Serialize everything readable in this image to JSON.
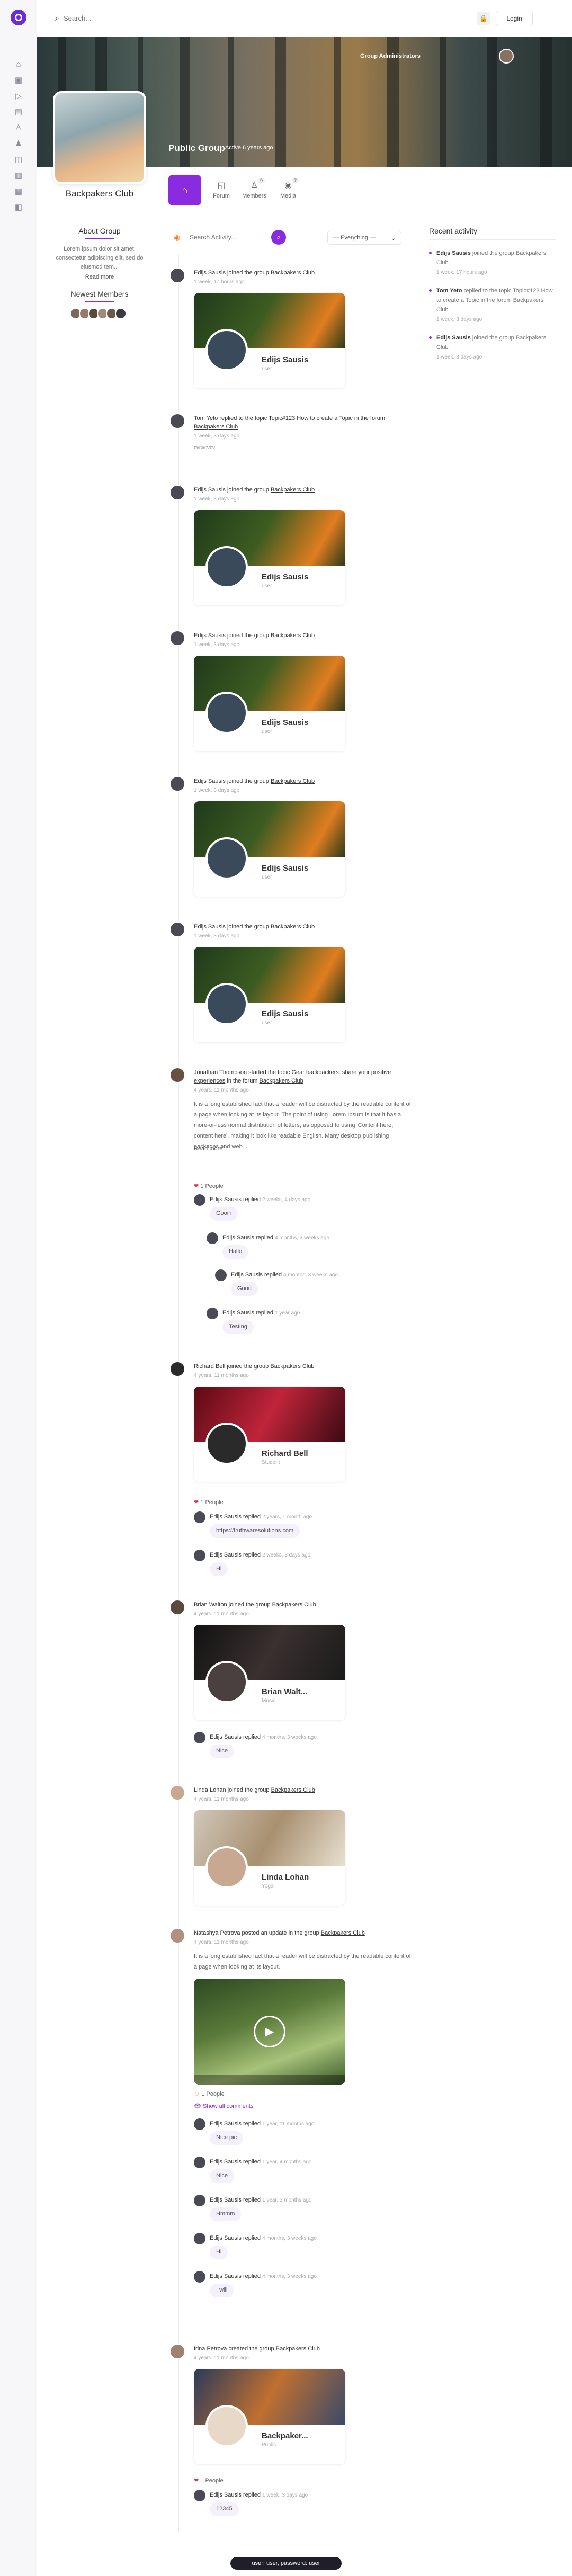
{
  "search": {
    "placeholder": "Search..."
  },
  "header": {
    "cart_icon": "cart-icon",
    "login_label": "Login"
  },
  "sidebar": {
    "icons": [
      "home-icon",
      "inbox-icon",
      "video-icon",
      "file-icon",
      "user-icon",
      "users-icon",
      "bookmark-icon",
      "store-icon",
      "book-icon",
      "shop-icon"
    ]
  },
  "cover": {
    "badge": "Group Administrators",
    "title": "Public Group",
    "subtitle": "Active 6 years ago"
  },
  "group": {
    "name": "Backpakers Club"
  },
  "tabs": [
    {
      "label": "",
      "icon": "home-icon"
    },
    {
      "label": "Forum",
      "icon": "forum-icon"
    },
    {
      "label": "Members",
      "icon": "members-icon",
      "count": "9"
    },
    {
      "label": "Media",
      "icon": "media-icon",
      "count": "7"
    }
  ],
  "about": {
    "title": "About Group",
    "text": "Lorem ipsum dolor sit amet, consectetur adipiscing elit, sed do eiusmod tem...",
    "read_more": "Read more"
  },
  "newest": {
    "title": "Newest Members"
  },
  "activity_search": {
    "placeholder": "Search Activity..."
  },
  "filter": {
    "label": "— Everything —"
  },
  "recent": {
    "title": "Recent activity",
    "items": [
      {
        "name": "Edijs Sausis",
        "text": "joined the group Backpakers Club",
        "time": "1 week, 17 hours ago"
      },
      {
        "name": "Tom Yeto",
        "text": "replied to the topic Topic#123 How to create a Topic in the forum Backpakers Club",
        "time": "1 week, 3 days ago"
      },
      {
        "name": "Edijs Sausis",
        "text": "joined the group Backpakers Club",
        "time": "1 week, 3 days ago"
      }
    ]
  },
  "feed": [
    {
      "name": "Edijs Sausis",
      "action": "joined the group",
      "group": "Backpakers Club",
      "time": "1 week, 17 hours ago",
      "card_name": "Edijs Sausis",
      "card_sub": "user"
    },
    {
      "name": "Tom Yeto",
      "action": "replied to the topic",
      "topic": "Topic#123 How to create a Topic",
      "in": "in the forum",
      "group": "Backpakers Club",
      "time": "1 week, 3 days ago",
      "extra": "cvcvcvcv"
    },
    {
      "name": "Edijs Sausis",
      "action": "joined the group",
      "group": "Backpakers Club",
      "time": "1 week, 3 days ago",
      "card_name": "Edijs Sausis",
      "card_sub": "user"
    },
    {
      "name": "Edijs Sausis",
      "action": "joined the group",
      "group": "Backpakers Club",
      "time": "1 week, 3 days ago",
      "card_name": "Edijs Sausis",
      "card_sub": "user"
    },
    {
      "name": "Edijs Sausis",
      "action": "joined the group",
      "group": "Backpakers Club",
      "time": "1 week, 3 days ago",
      "card_name": "Edijs Sausis",
      "card_sub": "user"
    },
    {
      "name": "Edijs Sausis",
      "action": "joined the group",
      "group": "Backpakers Club",
      "time": "1 week, 3 days ago",
      "card_name": "Edijs Sausis",
      "card_sub": "user"
    }
  ],
  "topic_post": {
    "name": "Jonathan Thompson",
    "action": "started the topic",
    "topic": "Gear backpackers: share your positive experiences",
    "in": "in the forum",
    "group": "Backpakers Club",
    "time": "4 years, 11 months ago",
    "text": "It is a long established fact that a reader will be distracted by the readable content of a page when looking at its layout. The point of using Lorem Ipsum is that it has a more-or-less normal distribution of letters, as opposed to using 'Content here, content here', making it look like readable English. Many desktop publishing packages and web...",
    "read_more": "Read more",
    "reactions": "1 People",
    "replies": [
      {
        "name": "Edijs Sausis",
        "action": "replied",
        "time": "2 weeks, 4 days ago",
        "text": "Gooin"
      },
      {
        "name": "Edijs Sausis",
        "action": "replied",
        "time": "4 months, 3 weeks ago",
        "text": "Hallo"
      },
      {
        "name": "Edijs Sausis",
        "action": "replied",
        "time": "4 months, 3 weeks ago",
        "text": "Good"
      },
      {
        "name": "Edijs Sausis",
        "action": "replied",
        "time": "1 year ago",
        "text": "Testing"
      }
    ]
  },
  "richard": {
    "name": "Richard Bell",
    "action": "joined the group",
    "group": "Backpakers Club",
    "time": "4 years, 11 months ago",
    "card_name": "Richard Bell",
    "card_sub": "Student",
    "reactions": "1 People",
    "replies": [
      {
        "name": "Edijs Sausis",
        "action": "replied",
        "time": "2 years, 1 month ago",
        "text": "https://truthwaresolutions.com"
      },
      {
        "name": "Edijs Sausis",
        "action": "replied",
        "time": "2 weeks, 3 days ago",
        "text": "Hi"
      }
    ]
  },
  "brian": {
    "name": "Brian Walton",
    "action": "joined the group",
    "group": "Backpakers Club",
    "time": "4 years, 11 months ago",
    "card_name": "Brian Walt...",
    "card_sub": "Music",
    "replies": [
      {
        "name": "Edijs Sausis",
        "action": "replied",
        "time": "4 months, 3 weeks ago",
        "text": "Nice"
      }
    ]
  },
  "linda": {
    "name": "Linda Lohan",
    "action": "joined the group",
    "group": "Backpakers Club",
    "time": "4 years, 11 months ago",
    "card_name": "Linda Lohan",
    "card_sub": "Yoga"
  },
  "natasha": {
    "name": "Natashya Petrova",
    "action": "posted an update in the group",
    "group": "Backpakers Club",
    "time": "4 years, 11 months ago",
    "text": "It is a long established fact that a reader will be distracted by the readable content of a page when looking at its layout.",
    "reactions": "1 People",
    "show_comments": "Show all comments",
    "replies": [
      {
        "name": "Edijs Sausis",
        "action": "replied",
        "time": "1 year, 11 months ago",
        "text": "Nice pic"
      },
      {
        "name": "Edijs Sausis",
        "action": "replied",
        "time": "1 year, 4 months ago",
        "text": "Nice"
      },
      {
        "name": "Edijs Sausis",
        "action": "replied",
        "time": "1 year, 3 months ago",
        "text": "Hmmm"
      },
      {
        "name": "Edijs Sausis",
        "action": "replied",
        "time": "4 months, 3 weeks ago",
        "text": "Hi"
      },
      {
        "name": "Edijs Sausis",
        "action": "replied",
        "time": "4 months, 3 weeks ago",
        "text": "I will"
      }
    ]
  },
  "irina": {
    "name": "Irina Petrova",
    "action": "created the group",
    "group": "Backpakers Club",
    "time": "4 years, 11 months ago",
    "card_name": "Backpaker...",
    "card_sub": "Public",
    "reactions": "1 People",
    "replies": [
      {
        "name": "Edijs Sausis",
        "action": "replied",
        "time": "1 week, 3 days ago",
        "text": "12345"
      }
    ]
  },
  "toast": {
    "text": "user: user, password: user"
  }
}
